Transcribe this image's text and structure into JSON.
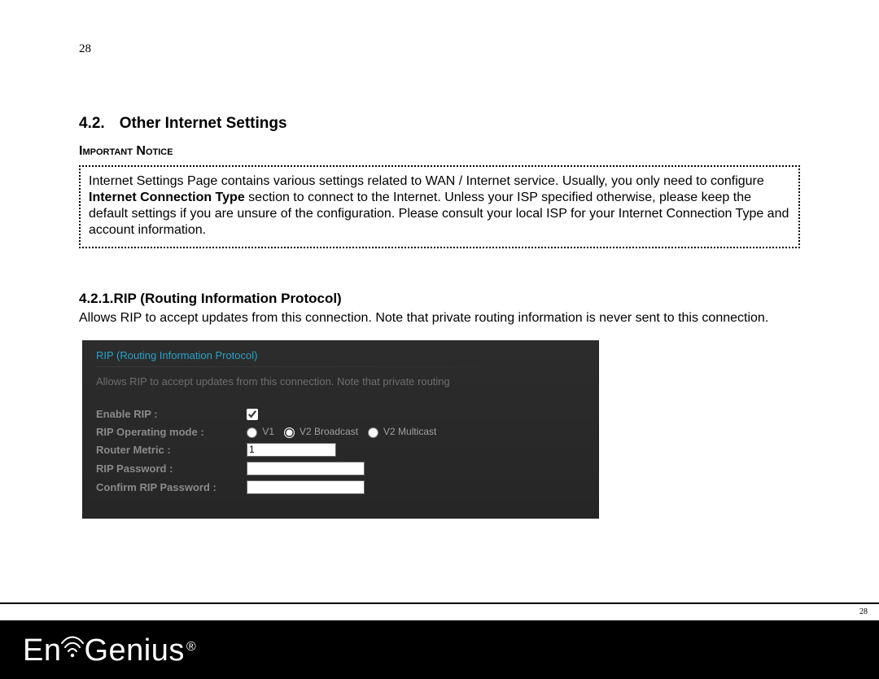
{
  "page_number_top": "28",
  "section": {
    "number": "4.2.",
    "title": "Other Internet Settings"
  },
  "notice": {
    "label": "Important Notice",
    "text_before_bold": "Internet Settings Page contains various settings related to WAN / Internet service. Usually, you only need to configure ",
    "bold": "Internet Connection Type",
    "text_after_bold": " section to connect to the Internet. Unless your ISP specified otherwise, please keep the default settings if you are unsure of the configuration. Please consult your local ISP for your Internet Connection Type and account information."
  },
  "subsection": {
    "number": "4.2.1.",
    "title": "RIP (Routing Information Protocol)",
    "body": "Allows RIP to accept updates from this connection. Note that private routing information is never sent to this connection."
  },
  "panel": {
    "title": "RIP (Routing Information Protocol)",
    "desc": "Allows RIP to accept updates from this connection. Note that private routing",
    "fields": {
      "enable_rip": "Enable RIP :",
      "enable_rip_checked": true,
      "mode_label": "RIP Operating mode :",
      "modes": {
        "v1": "V1",
        "v2b": "V2 Broadcast",
        "v2m": "V2 Multicast"
      },
      "mode_selected": "v2b",
      "router_metric_label": "Router Metric :",
      "router_metric_value": "1",
      "rip_password_label": "RIP Password :",
      "confirm_rip_password_label": "Confirm RIP Password :"
    }
  },
  "footer": {
    "page_number": "28",
    "brand_en": "En",
    "brand_genius": "Genius",
    "brand_reg": "®"
  }
}
